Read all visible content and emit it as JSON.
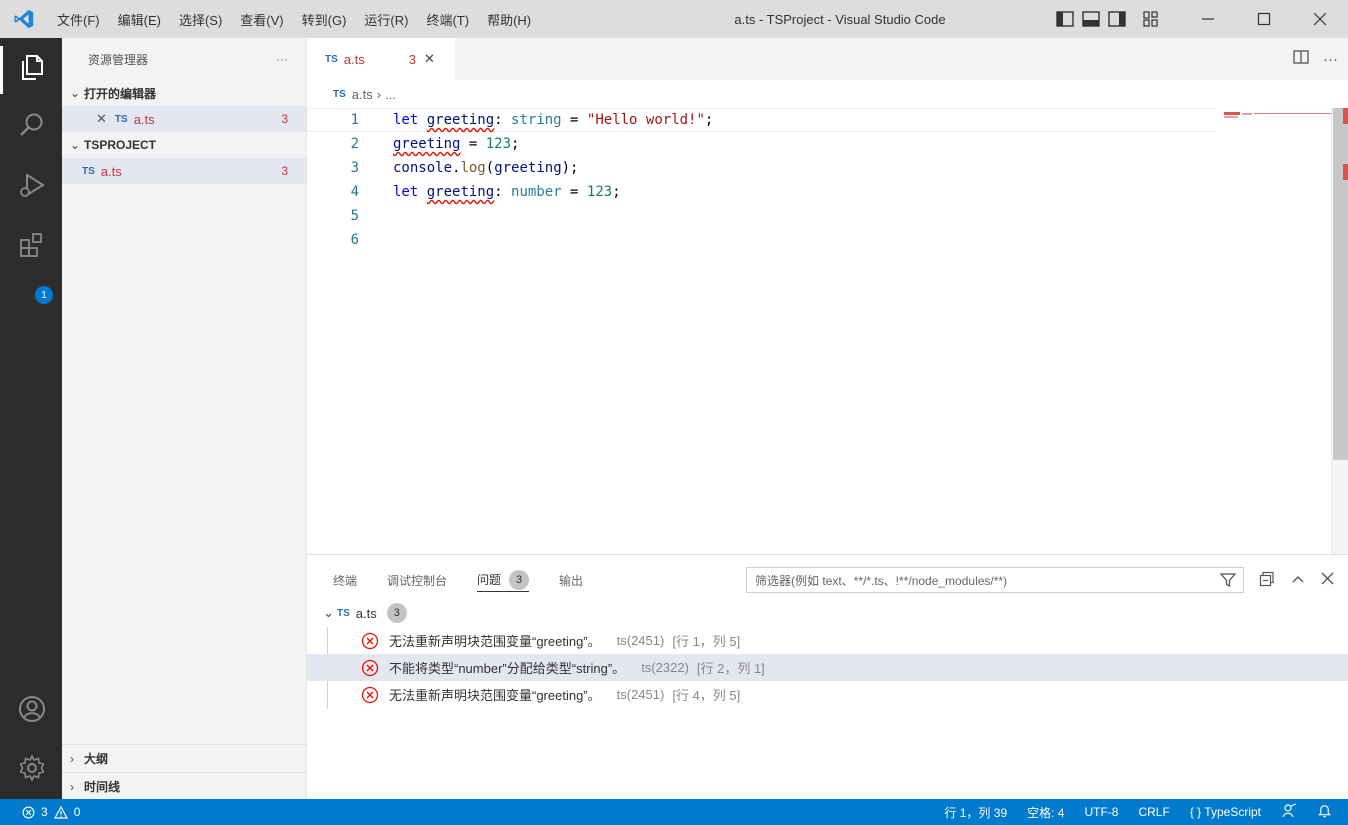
{
  "titlebar": {
    "menus": [
      "文件(F)",
      "编辑(E)",
      "选择(S)",
      "查看(V)",
      "转到(G)",
      "运行(R)",
      "终端(T)",
      "帮助(H)"
    ],
    "title": "a.ts - TSProject - Visual Studio Code"
  },
  "activitybar": {
    "icons": [
      "explorer-icon",
      "search-icon",
      "run-debug-icon",
      "extensions-icon",
      "account-icon",
      "settings-gear-icon"
    ],
    "extensions_badge": "1"
  },
  "sidebar": {
    "title": "资源管理器",
    "more": "···",
    "open_editors": {
      "label": "打开的编辑器",
      "files": [
        {
          "tag": "TS",
          "name": "a.ts",
          "errors": "3"
        }
      ]
    },
    "project": {
      "label": "TSPROJECT",
      "files": [
        {
          "tag": "TS",
          "name": "a.ts",
          "errors": "3"
        }
      ]
    },
    "outline_label": "大纲",
    "timeline_label": "时间线"
  },
  "editor": {
    "tab": {
      "tag": "TS",
      "name": "a.ts",
      "errors": "3"
    },
    "breadcrumb": {
      "tag": "TS",
      "file": "a.ts",
      "sep": "›",
      "rest": "..."
    },
    "line_numbers": [
      "1",
      "2",
      "3",
      "4",
      "5",
      "6"
    ],
    "code": {
      "l1": {
        "kw": "let",
        "var": "greeting",
        "colon": ": ",
        "type": "string",
        "eq": " = ",
        "str": "\"Hello world!\"",
        "end": ";"
      },
      "l2": {
        "var": "greeting",
        "eq": " = ",
        "num": "123",
        "end": ";"
      },
      "l3": {
        "obj": "console",
        "dot": ".",
        "fn": "log",
        "open": "(",
        "var": "greeting",
        "close": ");"
      },
      "l4": {
        "kw": "let",
        "var": "greeting",
        "colon": ": ",
        "type": "number",
        "eq": " = ",
        "num": "123",
        "end": ";"
      }
    }
  },
  "panel": {
    "tabs": [
      "终端",
      "调试控制台",
      "问题",
      "输出"
    ],
    "problems_count": "3",
    "filter_placeholder": "筛选器(例如 text、**/*.ts、!**/node_modules/**)",
    "file": {
      "tag": "TS",
      "name": "a.ts",
      "count": "3"
    },
    "problems": [
      {
        "msg": "无法重新声明块范围变量“greeting”。",
        "src": "ts(2451)",
        "loc": "[行 1，列 5]"
      },
      {
        "msg": "不能将类型“number”分配给类型“string”。",
        "src": "ts(2322)",
        "loc": "[行 2，列 1]"
      },
      {
        "msg": "无法重新声明块范围变量“greeting”。",
        "src": "ts(2451)",
        "loc": "[行 4，列 5]"
      }
    ]
  },
  "statusbar": {
    "errors": "3",
    "warnings": "0",
    "position": "行 1，列 39",
    "spaces": "空格: 4",
    "encoding": "UTF-8",
    "eol": "CRLF",
    "language_brace": "{ }",
    "language": "TypeScript"
  },
  "colors": {
    "statusbar": "#007acc",
    "activitybar": "#2c2c2c",
    "error": "#c03838"
  }
}
